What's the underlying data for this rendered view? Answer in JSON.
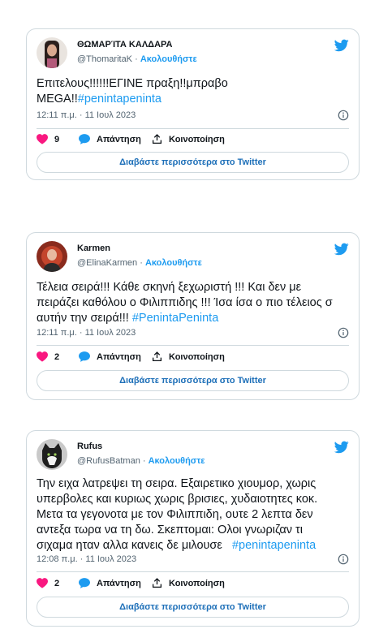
{
  "colors": {
    "accent": "#1d9bf0",
    "like": "#f91880",
    "border": "#cfd9de",
    "muted": "#536471"
  },
  "icons": {
    "bird": "twitter-bird-icon",
    "info": "info-icon",
    "like": "heart-icon",
    "reply": "speech-bubble-icon",
    "share": "share-icon"
  },
  "tweets": [
    {
      "display_name": "ΘΩΜΑΡΊΤΑ ΚΑΛΔΑΡΑ",
      "handle": "@ThomaritaK",
      "dot": " · ",
      "follow": "Ακολουθήστε",
      "text_lines": [
        "Επιτελους!!!!!!ΕΓΙΝΕ πραξη!!μπραβο",
        "MEGA!!"
      ],
      "hashtag": "#penintapeninta",
      "time": "12:11 π.μ. · 11 Ιουλ 2023",
      "likes": "9",
      "reply_label": "Απάντηση",
      "share_label": "Κοινοποίηση",
      "read_more": "Διαβάστε περισσότερα στο Twitter"
    },
    {
      "display_name": "Karmen",
      "handle": "@ElinaKarmen",
      "dot": " · ",
      "follow": "Ακολουθήστε",
      "text_lines": [
        "Τέλεια σειρά!!! Κάθε σκηνή ξεχωριστή !!! Και δεν με",
        "πειράζει καθόλου ο Φιλιππιδης !!! Ίσα ίσα ο πιο τέλειος σ",
        "αυτήν την σειρά!!! "
      ],
      "hashtag": "#PenintaPeninta",
      "time": "12:11 π.μ. · 11 Ιουλ 2023",
      "likes": "2",
      "reply_label": "Απάντηση",
      "share_label": "Κοινοποίηση",
      "read_more": "Διαβάστε περισσότερα στο Twitter"
    },
    {
      "display_name": "Rufus",
      "handle": "@RufusBatman",
      "dot": " · ",
      "follow": "Ακολουθήστε",
      "text_lines": [
        "Την ειχα λατρεψει τη σειρα. Εξαιρετικο χιουμορ, χωρις",
        "υπερβολες και κυριως χωρις βρισιες, χυδαιοτητες κοκ.",
        "Μετα τα γεγονοτα με τον Φιλιππιδη, ουτε 2 λεπτα δεν",
        "αντεξα τωρα να τη δω. Σκεπτομαι: Ολοι γνωριζαν τι",
        "σιχαμα ηταν αλλα κανεις δε μιλουσε   "
      ],
      "hashtag": "#penintapeninta",
      "time": "12:08 π.μ. · 11 Ιουλ 2023",
      "likes": "2",
      "reply_label": "Απάντηση",
      "share_label": "Κοινοποίηση",
      "read_more": "Διαβάστε περισσότερα στο Twitter"
    }
  ]
}
